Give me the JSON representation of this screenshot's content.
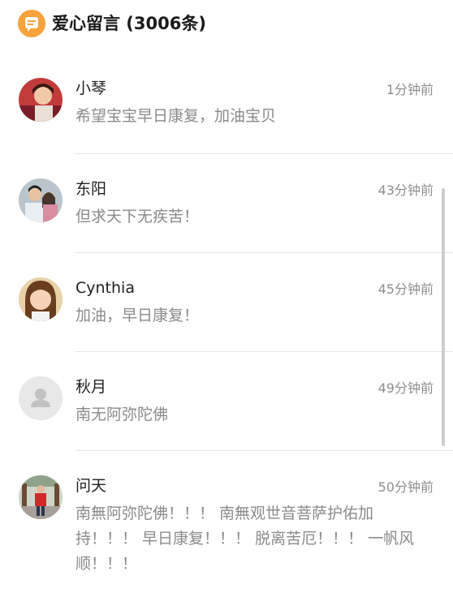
{
  "header": {
    "title": "爱心留言 (3006条)",
    "icon": "message-icon",
    "accent": "#f7a23a"
  },
  "messages": [
    {
      "name": "小琴",
      "time": "1分钟前",
      "text": "希望宝宝早日康复，加油宝贝",
      "avatar": "photo-avatar"
    },
    {
      "name": "东阳",
      "time": "43分钟前",
      "text": "但求天下无疾苦！",
      "avatar": "photo-avatar"
    },
    {
      "name": "Cynthia",
      "time": "45分钟前",
      "text": "加油，早日康复！",
      "avatar": "photo-avatar"
    },
    {
      "name": "秋月",
      "time": "49分钟前",
      "text": "南无阿弥陀佛",
      "avatar": "default-user-icon"
    },
    {
      "name": "问天",
      "time": "50分钟前",
      "text": "南無阿弥陀佛！！！ 南無观世音菩萨护佑加持！！！ 早日康复！！！ 脱离苦厄！！！ 一帆风顺！！！",
      "avatar": "photo-avatar"
    }
  ]
}
